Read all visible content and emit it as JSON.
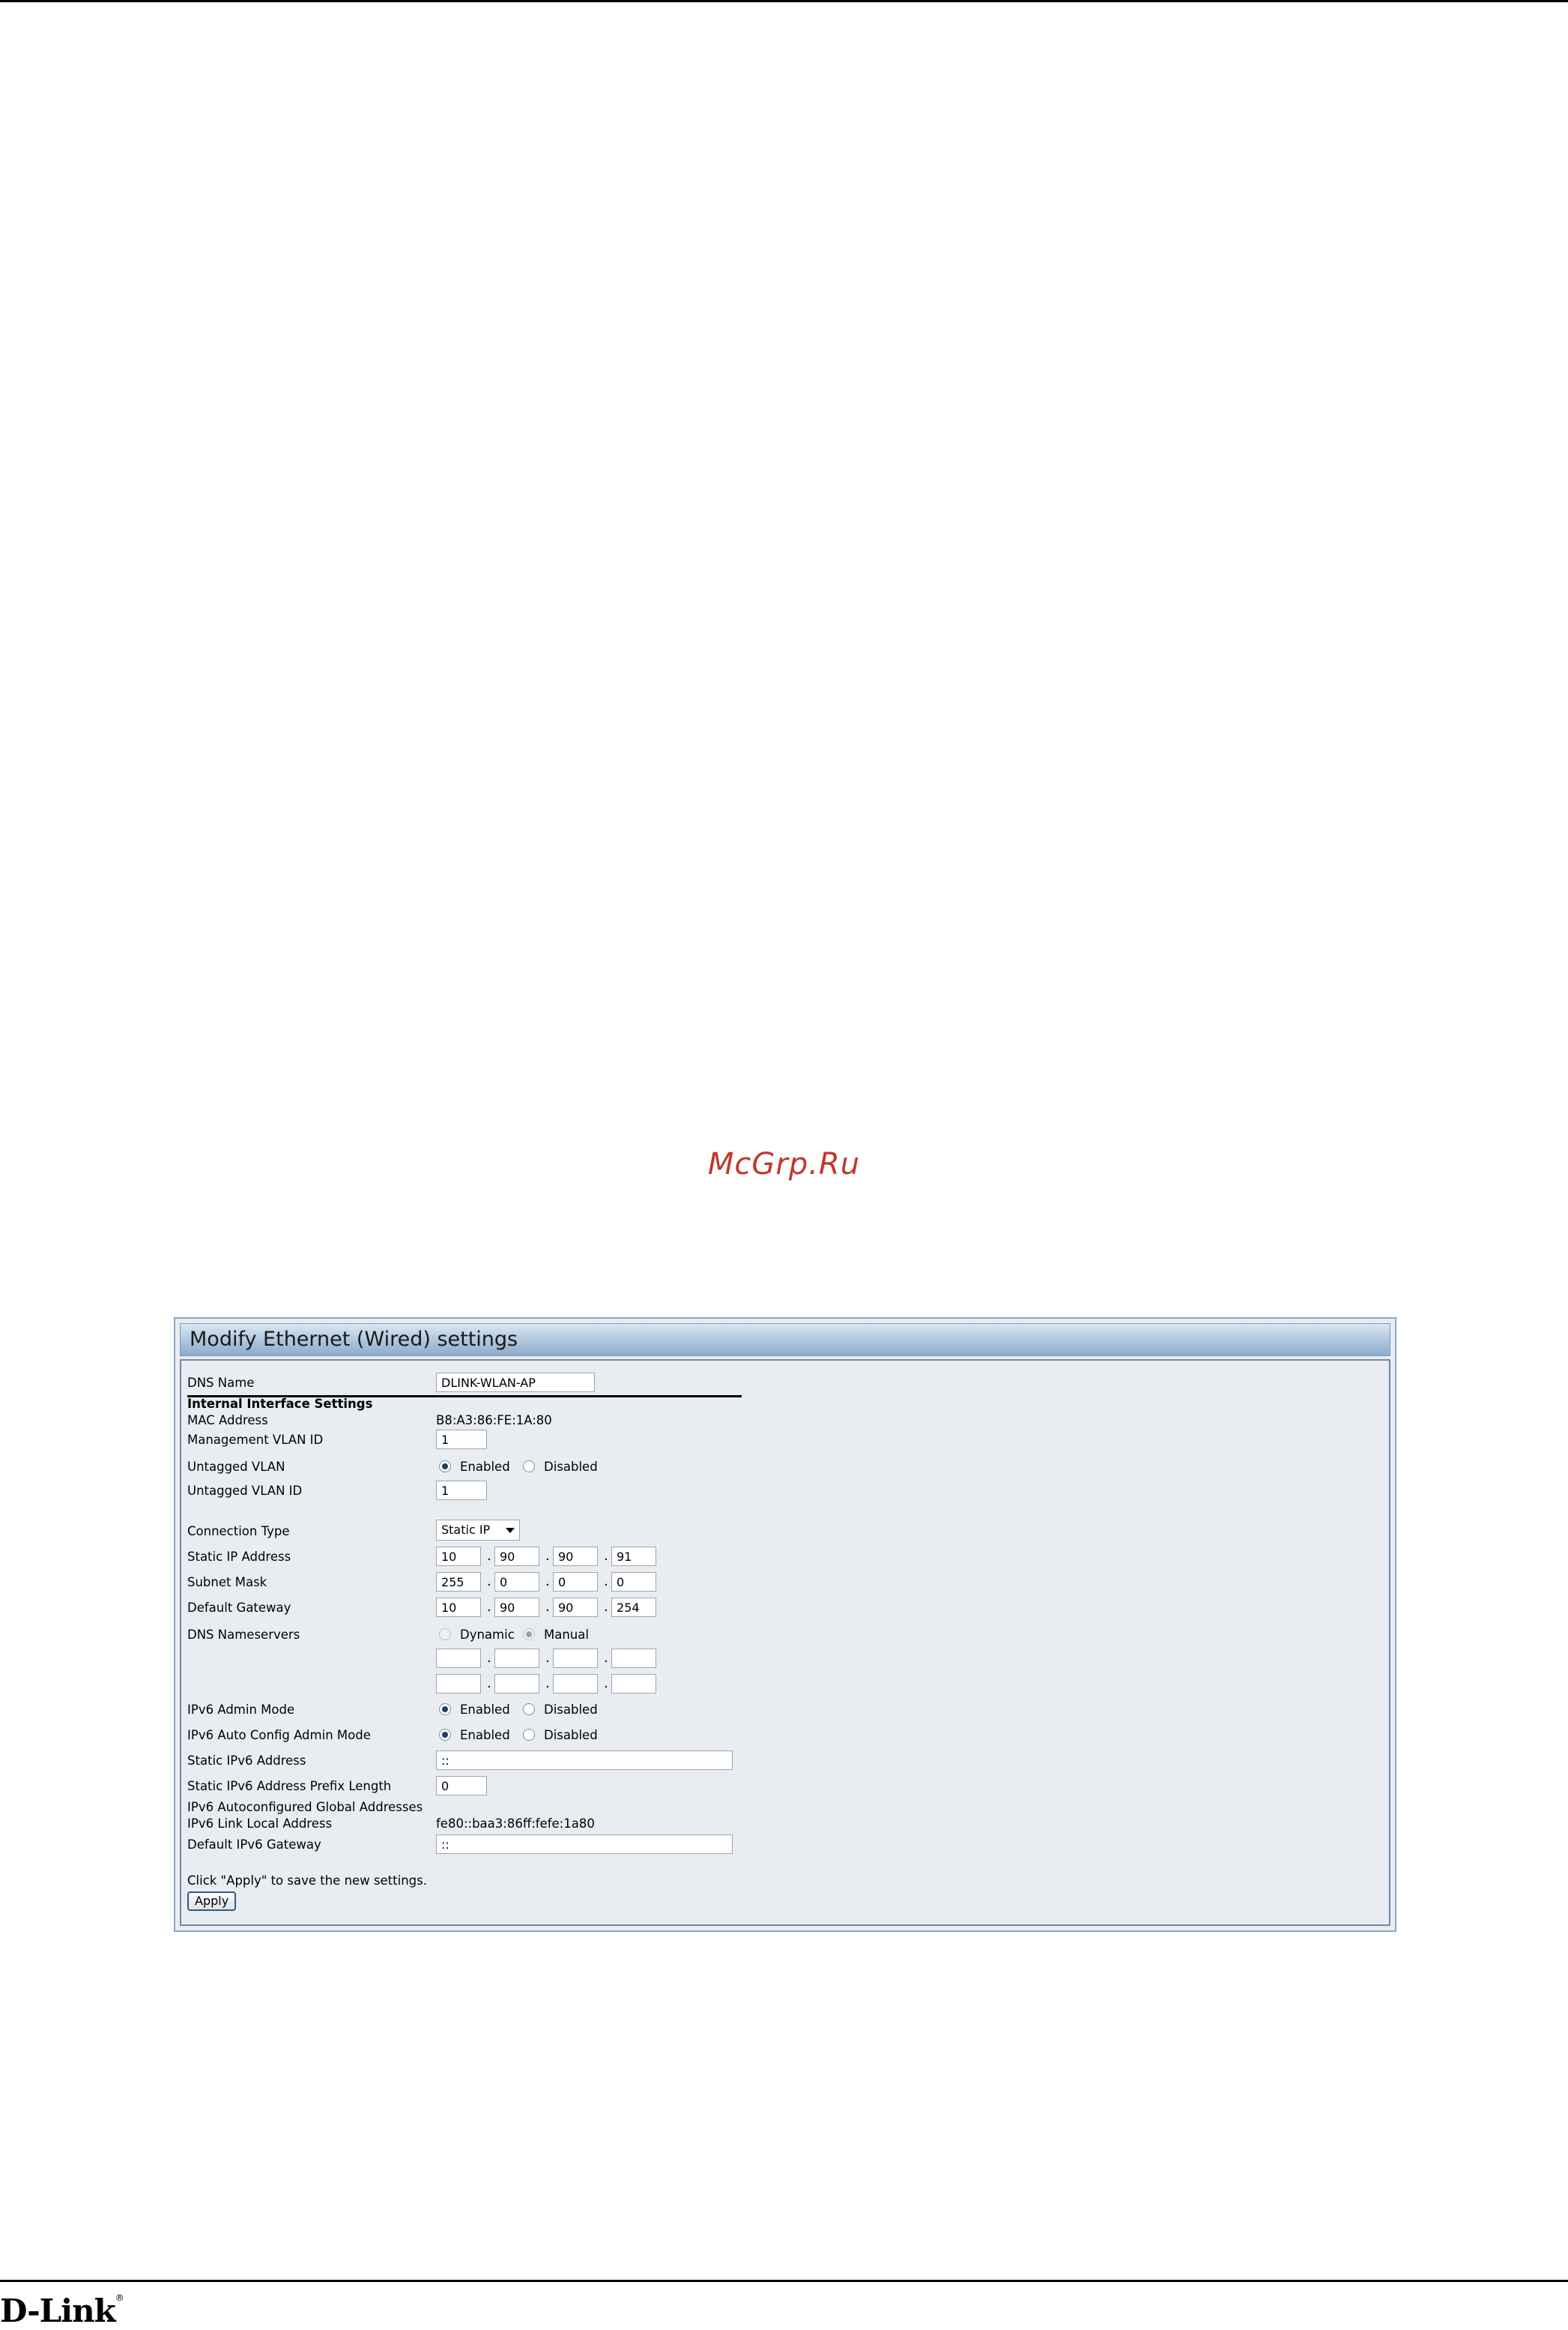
{
  "watermark": "McGrp.Ru",
  "brand": "D-Link",
  "panel": {
    "title": "Modify Ethernet (Wired) settings",
    "dns_name": {
      "label": "DNS Name",
      "value": "DLINK-WLAN-AP"
    },
    "section_title": "Internal Interface Settings",
    "mac_address": {
      "label": "MAC Address",
      "value": "B8:A3:86:FE:1A:80"
    },
    "management_vlan_id": {
      "label": "Management VLAN ID",
      "value": "1"
    },
    "untagged_vlan": {
      "label": "Untagged VLAN",
      "enabled_label": "Enabled",
      "disabled_label": "Disabled",
      "selected": "Enabled"
    },
    "untagged_vlan_id": {
      "label": "Untagged VLAN ID",
      "value": "1"
    },
    "connection_type": {
      "label": "Connection Type",
      "value": "Static IP"
    },
    "static_ip": {
      "label": "Static IP Address",
      "octets": [
        "10",
        "90",
        "90",
        "91"
      ]
    },
    "subnet_mask": {
      "label": "Subnet Mask",
      "octets": [
        "255",
        "0",
        "0",
        "0"
      ]
    },
    "default_gateway": {
      "label": "Default Gateway",
      "octets": [
        "10",
        "90",
        "90",
        "254"
      ]
    },
    "dns_nameservers": {
      "label": "DNS Nameservers",
      "dynamic_label": "Dynamic",
      "manual_label": "Manual",
      "selected": "Manual",
      "server1": [
        "",
        "",
        "",
        ""
      ],
      "server2": [
        "",
        "",
        "",
        ""
      ]
    },
    "ipv6_admin_mode": {
      "label": "IPv6 Admin Mode",
      "enabled_label": "Enabled",
      "disabled_label": "Disabled",
      "selected": "Enabled"
    },
    "ipv6_auto_config": {
      "label": "IPv6 Auto Config Admin Mode",
      "enabled_label": "Enabled",
      "disabled_label": "Disabled",
      "selected": "Enabled"
    },
    "static_ipv6_address": {
      "label": "Static IPv6 Address",
      "value": "::"
    },
    "static_ipv6_prefix": {
      "label": "Static IPv6 Address Prefix Length",
      "value": "0"
    },
    "ipv6_autoconf_global": {
      "label": "IPv6 Autoconfigured Global Addresses"
    },
    "ipv6_link_local": {
      "label": "IPv6 Link Local Address",
      "value": "fe80::baa3:86ff:fefe:1a80"
    },
    "default_ipv6_gateway": {
      "label": "Default IPv6 Gateway",
      "value": "::"
    },
    "hint": "Click \"Apply\" to save the new settings.",
    "apply_label": "Apply"
  }
}
